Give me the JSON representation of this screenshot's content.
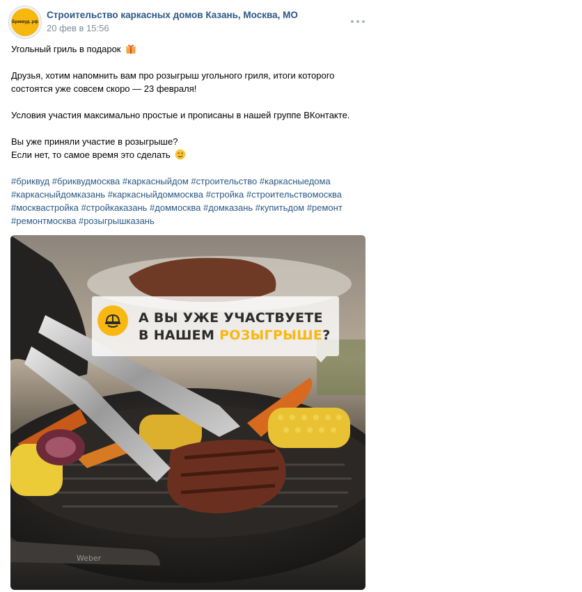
{
  "header": {
    "avatar_text": "Бриквуд .рф",
    "author": "Строительство каркасных домов Казань, Москва, МО",
    "date": "20 фев в 15:56"
  },
  "post": {
    "title": "Угольный гриль в подарок",
    "p1_line1": "Друзья, хотим напомнить вам про розыгрыш угольного гриля, итоги которого",
    "p1_line2": "состоятся уже совсем скоро — 23 февраля!",
    "p2": "Условия участия максимально простые и прописаны в нашей группе ВКонтакте.",
    "p3_line1": "Вы уже приняли участие в розыгрыше?",
    "p3_line2": "Если нет, то самое время это сделать",
    "hashtags": [
      "#бриквуд",
      "#бриквудмосква",
      "#каркасныйдом",
      "#строительство",
      "#каркасныедома",
      "#каркасныйдомказань",
      "#каркасныйдоммосква",
      "#стройка",
      "#строительствомосква",
      "#москвастройка",
      "#стройкаказань",
      "#доммосква",
      "#домказань",
      "#купитьдом",
      "#ремонт",
      "#ремонтмосква",
      "#розыгрышказань"
    ]
  },
  "photo": {
    "banner_line1": "А ВЫ УЖЕ УЧАСТВУЕТЕ",
    "banner_line2_prefix": "В НАШЕМ ",
    "banner_line2_accent": "РОЗЫГРЫШЕ",
    "banner_line2_suffix": "?",
    "grill_brand": "Weber"
  },
  "colors": {
    "link": "#2a5885",
    "date": "#818c99",
    "brand_yellow": "#f9b712"
  },
  "icons": [
    "more-icon",
    "gift-emoji-icon",
    "wink-emoji-icon",
    "helmet-icon"
  ]
}
